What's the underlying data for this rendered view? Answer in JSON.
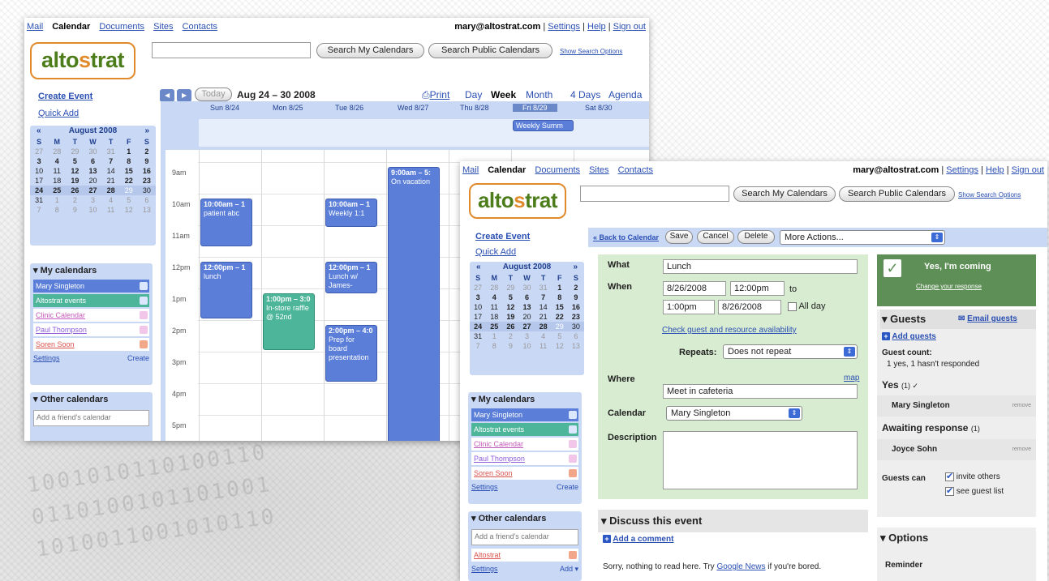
{
  "colors": {
    "accent_blue": "#2a4fb3",
    "event_blue": "#5b7fd9",
    "event_green": "#4db59a",
    "form_green": "#d8ecd1",
    "rsvp_green": "#5e8f56",
    "logo_green": "#4c7d1a",
    "logo_orange": "#e08a2c"
  },
  "nav": {
    "mail": "Mail",
    "calendar": "Calendar",
    "documents": "Documents",
    "sites": "Sites",
    "contacts": "Contacts"
  },
  "account": {
    "email": "mary@altostrat.com",
    "settings": "Settings",
    "help": "Help",
    "signout": "Sign out",
    "sep": "|"
  },
  "logo": {
    "left": "alto",
    "o": "s",
    "right": "trat"
  },
  "search": {
    "my": "Search My Calendars",
    "public": "Search Public Calendars",
    "options": "Show Search Options"
  },
  "side": {
    "create_event": "Create Event",
    "quick_add": "Quick Add"
  },
  "minical": {
    "month": "August 2008",
    "prev": "«",
    "next": "»",
    "dow": [
      "S",
      "M",
      "T",
      "W",
      "T",
      "F",
      "S"
    ],
    "weeks": [
      [
        "27",
        "28",
        "29",
        "30",
        "31",
        "1",
        "2"
      ],
      [
        "3",
        "4",
        "5",
        "6",
        "7",
        "8",
        "9"
      ],
      [
        "10",
        "11",
        "12",
        "13",
        "14",
        "15",
        "16"
      ],
      [
        "17",
        "18",
        "19",
        "20",
        "21",
        "22",
        "23"
      ],
      [
        "24",
        "25",
        "26",
        "27",
        "28",
        "29",
        "30"
      ],
      [
        "31",
        "1",
        "2",
        "3",
        "4",
        "5",
        "6"
      ],
      [
        "7",
        "8",
        "9",
        "10",
        "11",
        "12",
        "13"
      ]
    ]
  },
  "my_calendars": {
    "title": "▾ My calendars",
    "items": [
      {
        "name": "Mary Singleton",
        "color": "#5b7fd9"
      },
      {
        "name": "Altostrat events",
        "color": "#4db59a"
      },
      {
        "name": "Clinic Calendar",
        "color": "#c35ab8"
      },
      {
        "name": "Paul Thompson",
        "color": "#8d5bd9"
      },
      {
        "name": "Soren Soon",
        "color": "#d9534f"
      }
    ],
    "settings": "Settings",
    "create": "Create"
  },
  "other_calendars": {
    "title": "▾ Other calendars",
    "placeholder": "Add a friend's calendar",
    "item": "Altostrat",
    "settings": "Settings",
    "add": "Add ▾"
  },
  "week": {
    "today": "Today",
    "range": "Aug 24 – 30 2008",
    "print": "Print",
    "views": [
      "Day",
      "Week",
      "Month",
      "4 Days",
      "Agenda"
    ],
    "days": [
      "Sun 8/24",
      "Mon 8/25",
      "Tue 8/26",
      "Wed 8/27",
      "Thu 8/28",
      "Fri 8/29",
      "Sat 8/30"
    ],
    "allday_event": "Weekly Summ",
    "hours": [
      "9am",
      "10am",
      "11am",
      "12pm",
      "1pm",
      "2pm",
      "3pm",
      "4pm",
      "5pm"
    ],
    "events": [
      {
        "time": "10:00am – 1",
        "title": "patient abc",
        "color": "blue"
      },
      {
        "time": "12:00pm – 1",
        "title": "lunch",
        "color": "blue"
      },
      {
        "time": "1:00pm – 3:0",
        "title": "In-store raffle @ 52nd",
        "color": "green"
      },
      {
        "time": "10:00am – 1",
        "title": "Weekly 1:1",
        "color": "blue"
      },
      {
        "time": "12:00pm – 1",
        "title": "Lunch w/ James-",
        "color": "blue"
      },
      {
        "time": "2:00pm – 4:0",
        "title": "Prep for board presentation",
        "color": "blue"
      },
      {
        "time": "9:00am – 5:",
        "title": "On vacation",
        "color": "blue"
      }
    ]
  },
  "edit": {
    "back": "« Back to Calendar",
    "save": "Save",
    "cancel": "Cancel",
    "delete": "Delete",
    "more": "More Actions...",
    "what_label": "What",
    "what": "Lunch",
    "when_label": "When",
    "start_date": "8/26/2008",
    "start_time": "12:00pm",
    "to": "to",
    "end_time": "1:00pm",
    "end_date": "8/26/2008",
    "allday": "All day",
    "check_avail": "Check guest and resource availability",
    "repeats_label": "Repeats:",
    "repeats": "Does not repeat",
    "where_label": "Where",
    "where": "Meet in cafeteria",
    "map": "map",
    "calendar_label": "Calendar",
    "calendar": "Mary Singleton",
    "description_label": "Description"
  },
  "rsvp": {
    "status": "Yes, I'm coming",
    "change": "Change your response"
  },
  "guests": {
    "title": "▾ Guests",
    "email": "Email guests",
    "add": "Add guests",
    "count_label": "Guest count:",
    "count": "1 yes, 1 hasn't responded",
    "yes": "Yes",
    "yes_count": "(1) ✓",
    "guest1": "Mary Singleton",
    "remove": "remove",
    "awaiting": "Awaiting response",
    "awaiting_count": "(1)",
    "guest2": "Joyce Sohn",
    "can_label": "Guests can",
    "invite": "invite others",
    "see": "see guest list"
  },
  "discuss": {
    "title": "▾ Discuss this event",
    "add_comment": "Add a comment",
    "note_prefix": "Sorry, nothing to read here. Try ",
    "note_link": "Google News",
    "note_suffix": " if you're bored."
  },
  "options": {
    "title": "▾ Options",
    "reminder": "Reminder"
  },
  "bg_binary": "1001010110100110 0110100101101001 1010011001010110"
}
